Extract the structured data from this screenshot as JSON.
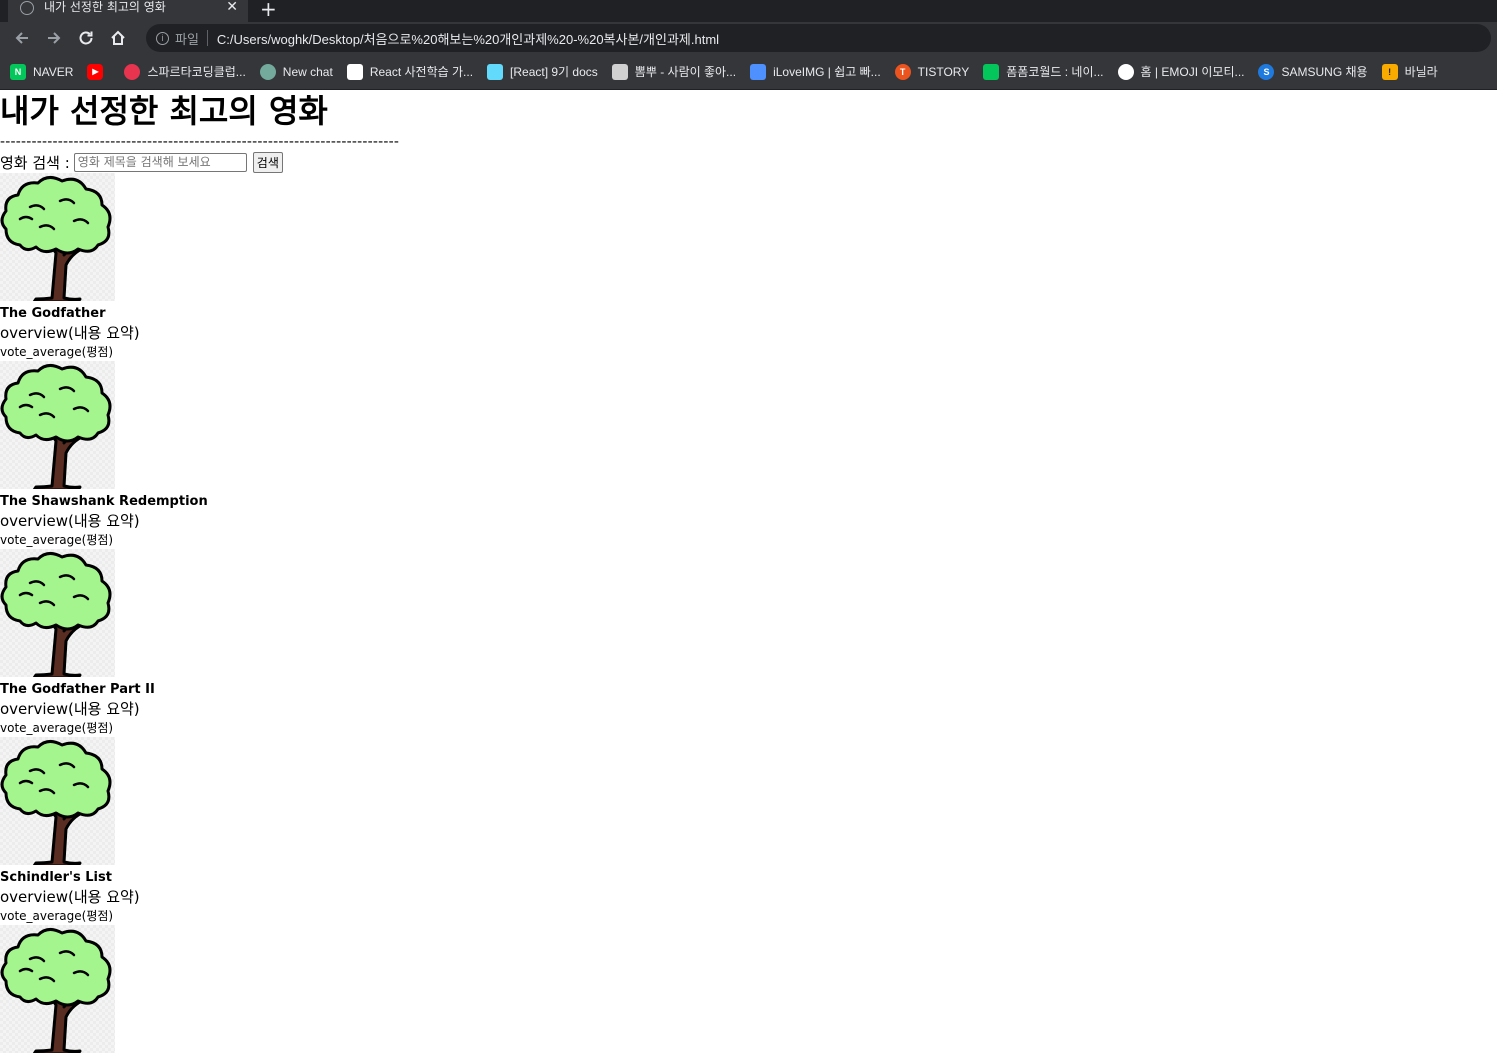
{
  "browser": {
    "tab_title": "내가 선정한 최고의 영화",
    "scheme_label": "파일",
    "url": "C:/Users/woghk/Desktop/처음으로%20해보는%20개인과제%20-%20복사본/개인과제.html",
    "bookmarks": [
      {
        "label": "NAVER",
        "icon": "naver-icon",
        "color": "#03c75a"
      },
      {
        "label": "",
        "icon": "youtube-icon",
        "color": "#ff0000"
      },
      {
        "label": "스파르타코딩클럽...",
        "icon": "sparta-icon",
        "color": "#e8344e"
      },
      {
        "label": "New chat",
        "icon": "chatgpt-icon",
        "color": "#74aa9c"
      },
      {
        "label": "React 사전학습 가...",
        "icon": "notion-icon",
        "color": "#ffffff"
      },
      {
        "label": "[React] 9기 docs",
        "icon": "react-icon",
        "color": "#61dafb"
      },
      {
        "label": "뽐뿌 - 사람이 좋아...",
        "icon": "ppomppu-icon",
        "color": "#d0d0d0"
      },
      {
        "label": "iLoveIMG | 쉽고 빠...",
        "icon": "iloveimg-icon",
        "color": "#4d90fe"
      },
      {
        "label": "TISTORY",
        "icon": "tistory-icon",
        "color": "#eb531f"
      },
      {
        "label": "폼폼코월드 : 네이...",
        "icon": "blog-icon",
        "color": "#03c75a"
      },
      {
        "label": "홈 | EMOJI 이모티...",
        "icon": "emoji-icon",
        "color": "#ffffff"
      },
      {
        "label": "SAMSUNG 채용",
        "icon": "samsung-icon",
        "color": "#1f7ae0"
      },
      {
        "label": "바닐라",
        "icon": "warning-icon",
        "color": "#f9ab00"
      }
    ]
  },
  "page": {
    "title": "내가 선정한 최고의 영화",
    "divider": "----------------------------------------------------------------------------",
    "search": {
      "label": "영화 검색 :",
      "placeholder": "영화 제목을 검색해 보세요",
      "button_label": "검색"
    },
    "movies": [
      {
        "title": "The Godfather",
        "overview": "overview(내용 요약)",
        "vote": "vote_average(평점)"
      },
      {
        "title": "The Shawshank Redemption",
        "overview": "overview(내용 요약)",
        "vote": "vote_average(평점)"
      },
      {
        "title": "The Godfather Part II",
        "overview": "overview(내용 요약)",
        "vote": "vote_average(평점)"
      },
      {
        "title": "Schindler's List",
        "overview": "overview(내용 요약)",
        "vote": "vote_average(평점)"
      },
      {
        "title": "",
        "overview": "",
        "vote": ""
      }
    ]
  },
  "colors": {
    "chrome_dark": "#202124",
    "chrome_toolbar": "#35363a",
    "tree_leaf": "#a4f58e",
    "tree_trunk": "#5a2d22"
  }
}
